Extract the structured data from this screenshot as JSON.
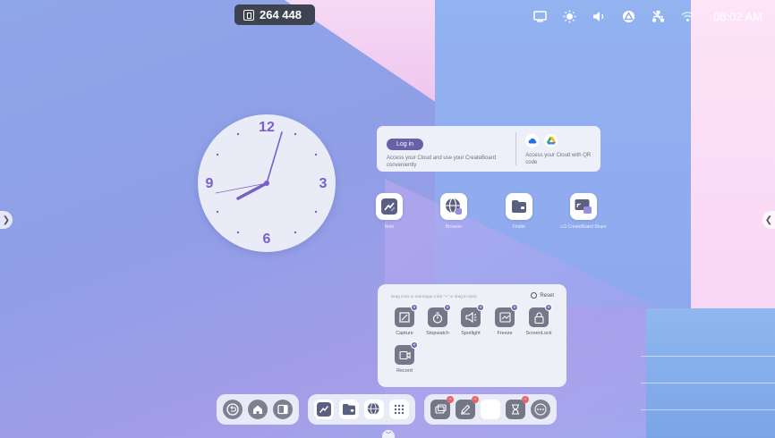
{
  "counter": {
    "value": "264 448"
  },
  "statusbar": {
    "time": "08:02 AM"
  },
  "clock": {
    "numerals": [
      "12",
      "3",
      "6",
      "9"
    ]
  },
  "cloud": {
    "login_label": "Log in",
    "left_text": "Access your Cloud and use your CreateBoard conveniently",
    "right_text": "Access your Cloud with QR code"
  },
  "apps": [
    {
      "label": "Note"
    },
    {
      "label": "Browser"
    },
    {
      "label": "Finder"
    },
    {
      "label": "LG CreateBoard Share"
    }
  ],
  "tools": {
    "hint": "Drag tools to rearrange.Click \"+\" or drag to dock.",
    "reset_label": "Reset",
    "items": [
      {
        "label": "Capture"
      },
      {
        "label": "Stopwatch"
      },
      {
        "label": "Spotlight"
      },
      {
        "label": "Freeze"
      },
      {
        "label": "ScreenLock"
      },
      {
        "label": "Record"
      }
    ]
  }
}
